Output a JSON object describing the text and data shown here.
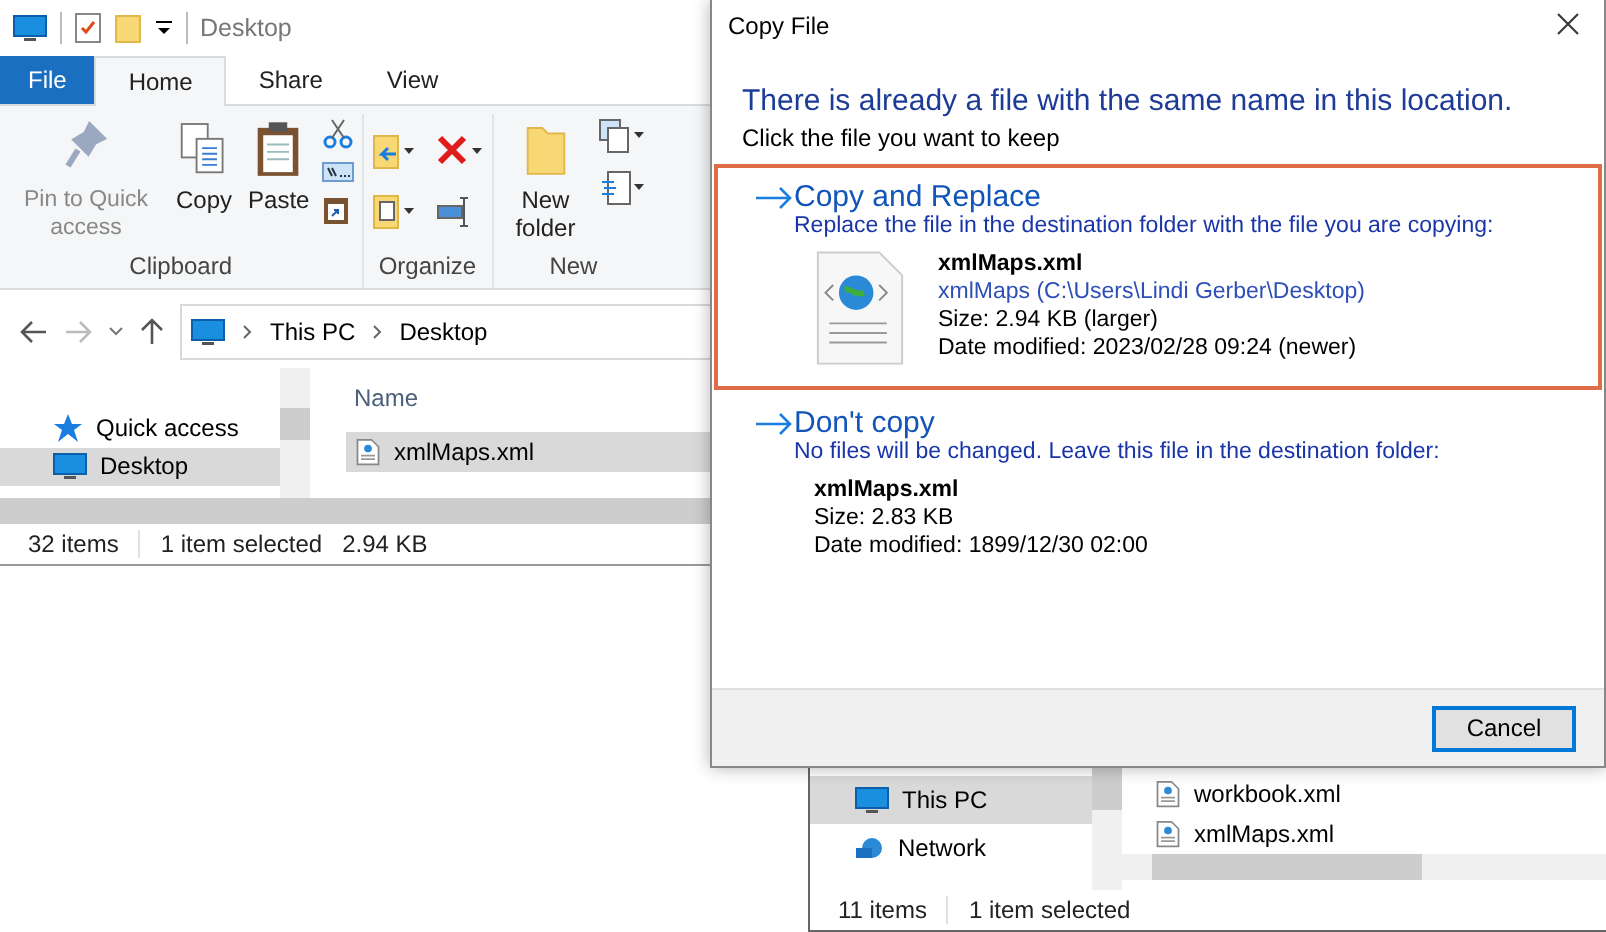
{
  "explorer": {
    "title": "Desktop",
    "ribbon_tabs": [
      {
        "label": "File",
        "kind": "file",
        "selected": false
      },
      {
        "label": "Home",
        "kind": "tab",
        "selected": true
      },
      {
        "label": "Share",
        "kind": "tab",
        "selected": false
      },
      {
        "label": "View",
        "kind": "tab",
        "selected": false
      }
    ],
    "clipboard": {
      "label": "Clipboard",
      "buttons": [
        {
          "label": "Pin to Quick access",
          "disabled": true
        },
        {
          "label": "Copy",
          "disabled": false
        },
        {
          "label": "Paste",
          "disabled": false
        }
      ]
    },
    "organize": {
      "label": "Organize"
    },
    "new": {
      "label": "New",
      "button": "New folder"
    },
    "breadcrumb": [
      "This PC",
      "Desktop"
    ],
    "nav": [
      {
        "label": "Quick access",
        "kind": "star",
        "selected": false
      },
      {
        "label": "Desktop",
        "kind": "desktop",
        "selected": true
      }
    ],
    "column": "Name",
    "files": [
      {
        "name": "xmlMaps.xml",
        "selected": true
      }
    ],
    "status": [
      "32 items",
      "1 item selected",
      "2.94 KB"
    ]
  },
  "dialog": {
    "title": "Copy File",
    "heading": "There is already a file with the same name in this location.",
    "subheading": "Click the file you want to keep",
    "options": [
      {
        "title": "Copy and Replace",
        "description": "Replace the file in the destination folder with the file you are copying:",
        "selected": true,
        "file": {
          "name": "xmlMaps.xml",
          "location": "xmlMaps (C:\\Users\\Lindi Gerber\\Desktop)",
          "size": "Size: 2.94 KB (larger)",
          "modified": "Date modified: 2023/02/28 09:24 (newer)"
        }
      },
      {
        "title": "Don't copy",
        "description": "No files will be changed. Leave this file in the destination folder:",
        "selected": false,
        "file": {
          "name": "xmlMaps.xml",
          "size": "Size: 2.83 KB",
          "modified": "Date modified: 1899/12/30 02:00"
        }
      }
    ],
    "button": "Cancel"
  },
  "explorer_2": {
    "nav": [
      {
        "label": "This PC",
        "selected": true
      },
      {
        "label": "Network",
        "selected": false
      }
    ],
    "files": [
      {
        "name": "workbook.xml",
        "selected": false
      },
      {
        "name": "xmlMaps.xml",
        "selected": false
      }
    ],
    "status": [
      "11 items",
      "1 item selected"
    ]
  }
}
